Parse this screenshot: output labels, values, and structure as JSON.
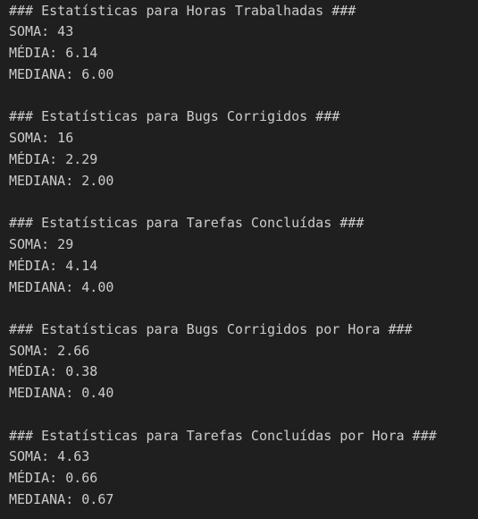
{
  "terminal": {
    "sections": [
      {
        "header": "### Estatísticas para Horas Trabalhadas ###",
        "soma": "SOMA: 43",
        "media": "MÉDIA: 6.14",
        "mediana": "MEDIANA: 6.00"
      },
      {
        "header": "### Estatísticas para Bugs Corrigidos ###",
        "soma": "SOMA: 16",
        "media": "MÉDIA: 2.29",
        "mediana": "MEDIANA: 2.00"
      },
      {
        "header": "### Estatísticas para Tarefas Concluídas ###",
        "soma": "SOMA: 29",
        "media": "MÉDIA: 4.14",
        "mediana": "MEDIANA: 4.00"
      },
      {
        "header": "### Estatísticas para Bugs Corrigidos por Hora ###",
        "soma": "SOMA: 2.66",
        "media": "MÉDIA: 0.38",
        "mediana": "MEDIANA: 0.40"
      },
      {
        "header": "### Estatísticas para Tarefas Concluídas por Hora ###",
        "soma": "SOMA: 4.63",
        "media": "MÉDIA: 0.66",
        "mediana": "MEDIANA: 0.67"
      }
    ]
  }
}
